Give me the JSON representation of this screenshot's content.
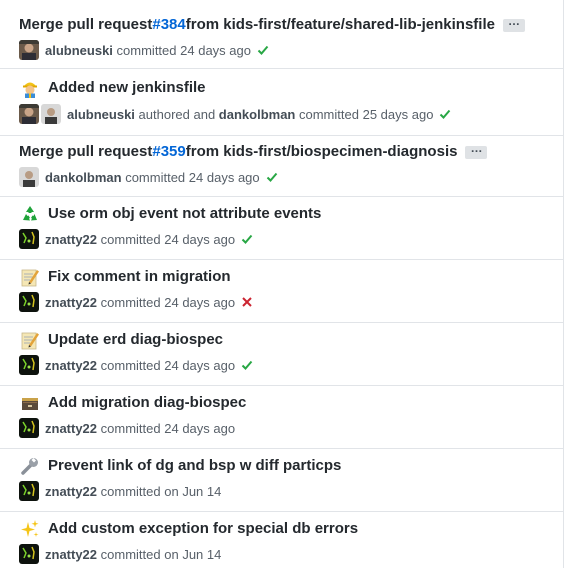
{
  "commits": [
    {
      "emoji": "",
      "prefix": "Merge pull request ",
      "issue": "#384",
      "suffix": " from kids-first/feature/shared-lib-jenkinsfile",
      "authors": [
        "alubneuski"
      ],
      "verb": "committed",
      "time": "24 days ago",
      "status": "success"
    },
    {
      "emoji": "construction-worker-icon",
      "prefix": "Added new jenkinsfile",
      "issue": "",
      "suffix": "",
      "authors": [
        "alubneuski",
        "dankolbman"
      ],
      "connector": "authored and",
      "verb": "committed",
      "time": "25 days ago",
      "status": "success"
    },
    {
      "emoji": "",
      "prefix": "Merge pull request ",
      "issue": "#359",
      "suffix": " from kids-first/biospecimen-diagnosis",
      "authors": [
        "dankolbman"
      ],
      "verb": "committed",
      "time": "24 days ago",
      "status": "success"
    },
    {
      "emoji": "recycle-icon",
      "prefix": "Use orm obj event not attribute events",
      "issue": "",
      "suffix": "",
      "authors": [
        "znatty22"
      ],
      "verb": "committed",
      "time": "24 days ago",
      "status": "success"
    },
    {
      "emoji": "memo-icon",
      "prefix": "Fix comment in migration",
      "issue": "",
      "suffix": "",
      "authors": [
        "znatty22"
      ],
      "verb": "committed",
      "time": "24 days ago",
      "status": "failure"
    },
    {
      "emoji": "memo-icon",
      "prefix": "Update erd diag-biospec",
      "issue": "",
      "suffix": "",
      "authors": [
        "znatty22"
      ],
      "verb": "committed",
      "time": "24 days ago",
      "status": "success"
    },
    {
      "emoji": "card-file-box-icon",
      "prefix": "Add migration diag-biospec",
      "issue": "",
      "suffix": "",
      "authors": [
        "znatty22"
      ],
      "verb": "committed",
      "time": "24 days ago",
      "status": "none"
    },
    {
      "emoji": "wrench-icon",
      "prefix": "Prevent link of dg and bsp w diff particps",
      "issue": "",
      "suffix": "",
      "authors": [
        "znatty22"
      ],
      "verb": "committed on",
      "time": "Jun 14",
      "status": "none"
    },
    {
      "emoji": "sparkles-icon",
      "prefix": "Add custom exception for special db errors",
      "issue": "",
      "suffix": "",
      "authors": [
        "znatty22"
      ],
      "verb": "committed on",
      "time": "Jun 14",
      "status": "none"
    }
  ],
  "colors": {
    "link": "#0366d6",
    "success": "#28a745",
    "failure": "#cb2431",
    "border": "#e1e4e8",
    "muted": "#586069"
  }
}
